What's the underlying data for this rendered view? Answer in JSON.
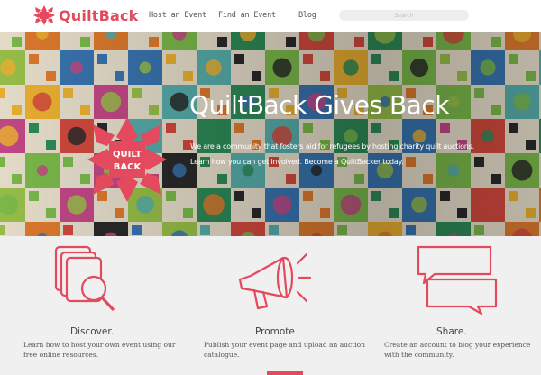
{
  "brand": {
    "name": "QuiltBack",
    "accent": "#e34a5e"
  },
  "nav": {
    "links": [
      "Host an Event",
      "Find an Event",
      "Blog"
    ],
    "search_placeholder": "Search"
  },
  "hero": {
    "badge_line1": "QUILT",
    "badge_line2": "BACK",
    "title": "QuiltBack Gives Back",
    "text_line1": "We are a community that fosters aid for refugees by hosting charity quilt auctions.",
    "text_line2": "Learn how you can get involved. Become a QuiltBacker today."
  },
  "features": [
    {
      "icon": "documents-magnifier-icon",
      "title": "Discover.",
      "text": "Learn how to host your own event using our free online resources."
    },
    {
      "icon": "megaphone-icon",
      "title": "Promote",
      "text": "Publish your event page and upload an auction catalogue."
    },
    {
      "icon": "speech-bubbles-icon",
      "title": "Share.",
      "text": "Create an account to blog your experience with the community."
    }
  ]
}
